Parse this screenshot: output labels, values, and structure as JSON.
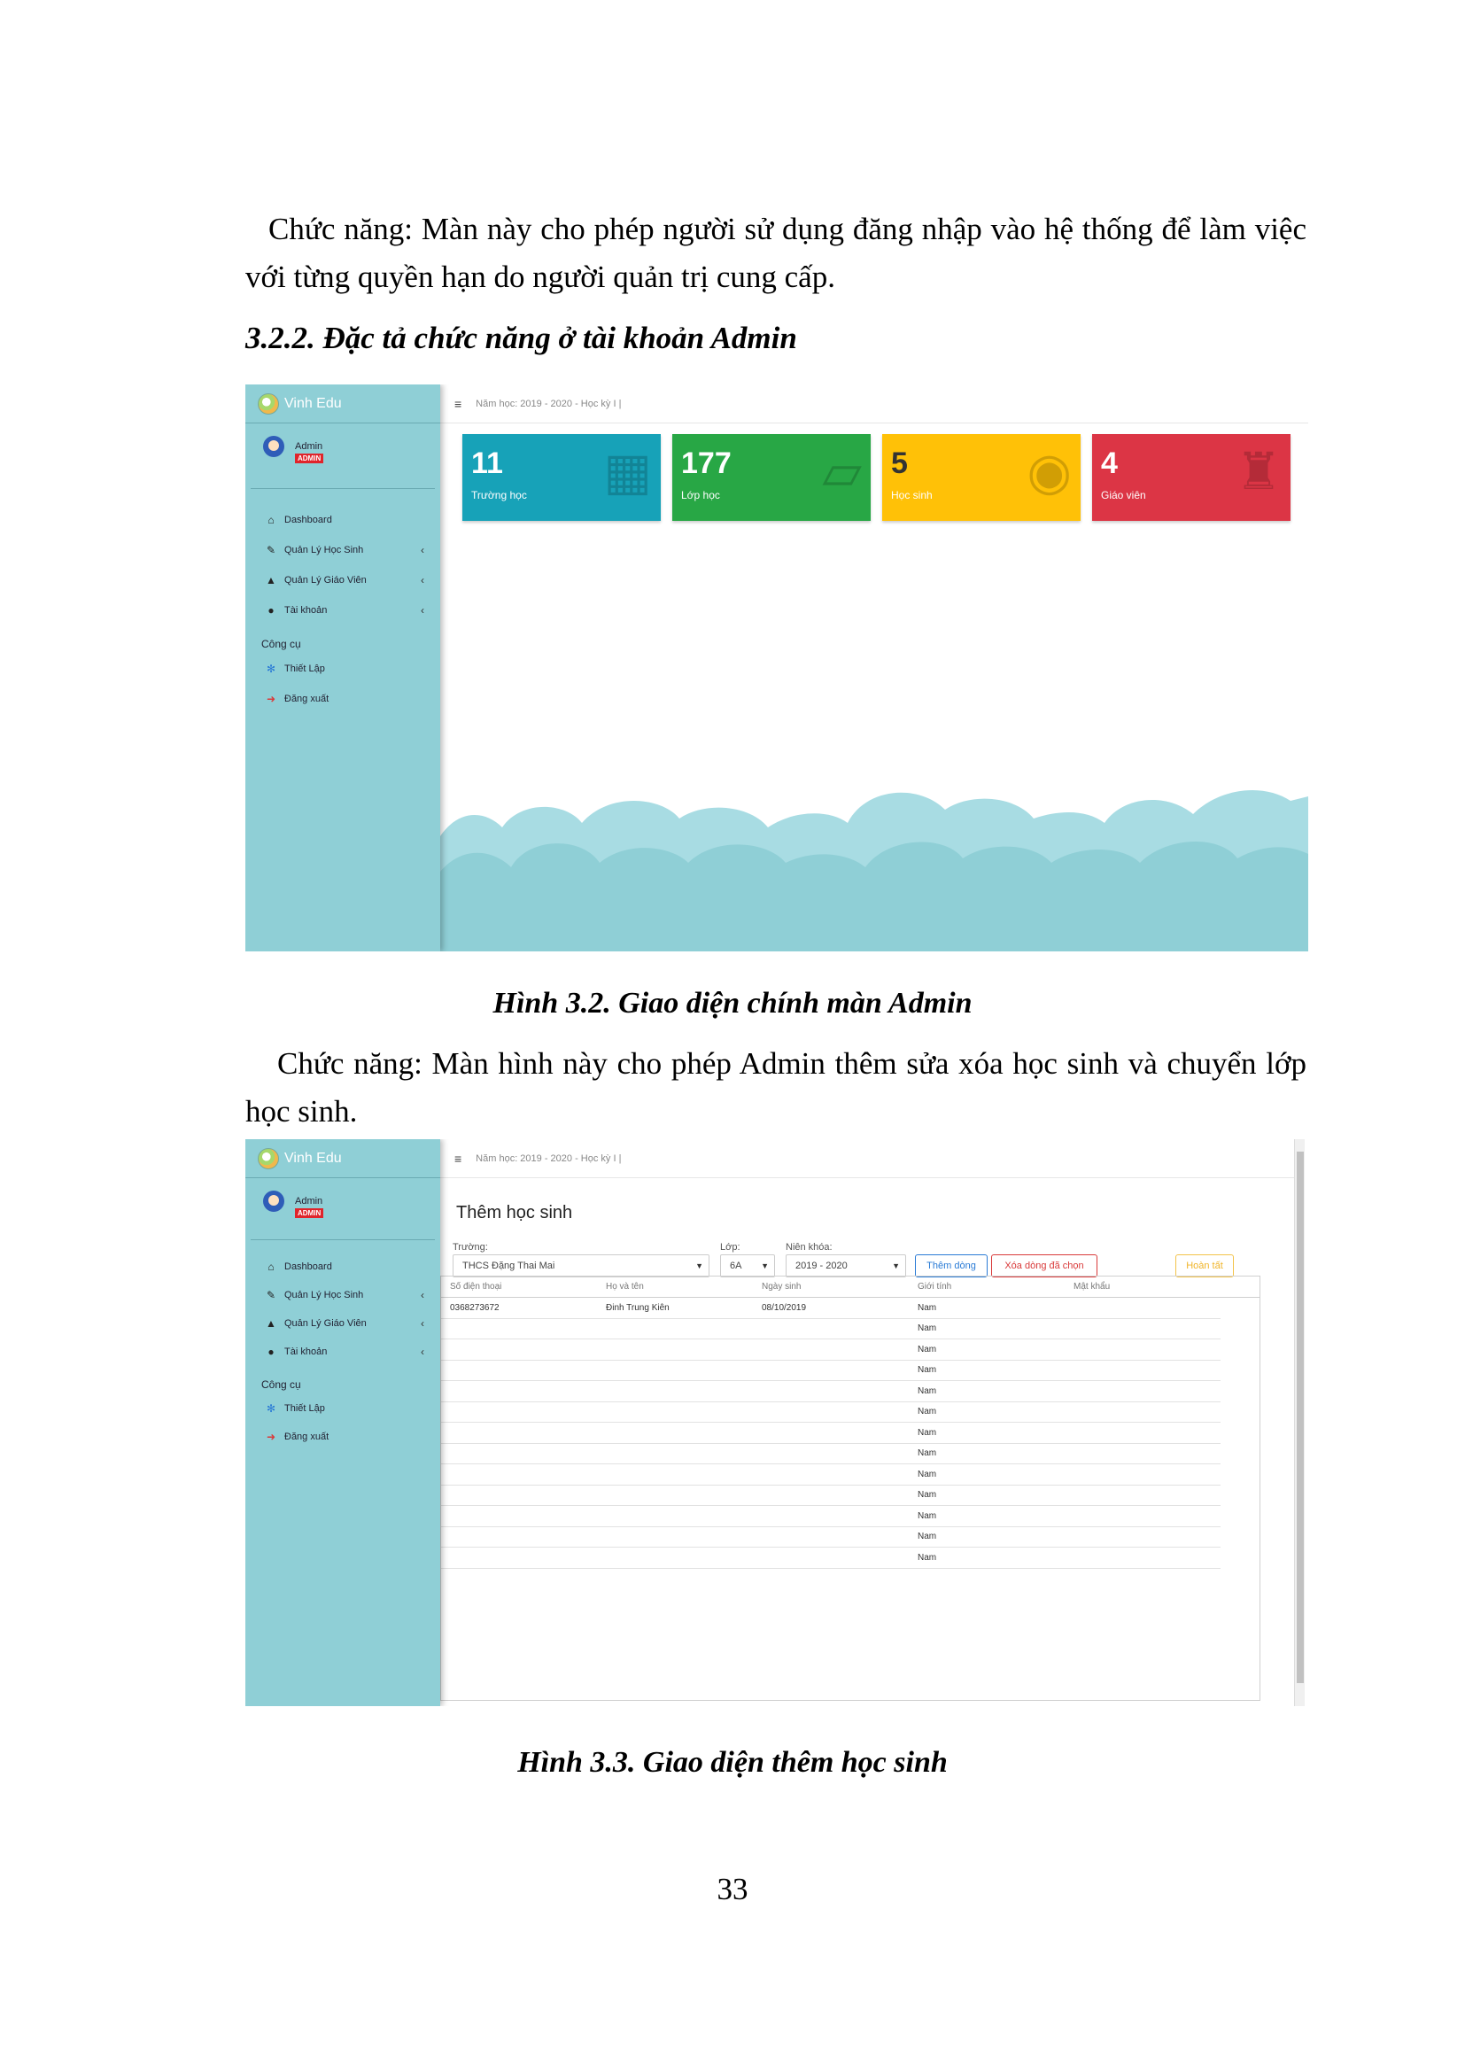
{
  "document": {
    "para1": "Chức năng: Màn này cho phép người sử dụng đăng nhập vào hệ thống để làm việc với từng quyền hạn do người quản trị cung cấp.",
    "heading": "3.2.2. Đặc tả chức năng ở tài khoản Admin",
    "caption1": "Hình 3.2. Giao diện chính màn Admin",
    "para2": "Chức năng: Màn hình này cho phép Admin thêm sửa xóa học sinh và chuyển lớp học sinh.",
    "caption2": "Hình 3.3. Giao diện thêm học sinh",
    "page_number": "33"
  },
  "app": {
    "brand": "Vinh Edu",
    "user_name": "Admin",
    "user_badge": "ADMIN",
    "topbar_text": "Năm học: 2019 - 2020 - Học kỳ I |",
    "menu": [
      {
        "label": "Dashboard",
        "icon": "home-icon"
      },
      {
        "label": "Quản Lý Học Sinh",
        "icon": "edit-icon",
        "chevron": "‹"
      },
      {
        "label": "Quản Lý Giáo Viên",
        "icon": "graduation-cap-icon",
        "chevron": "‹"
      },
      {
        "label": "Tài khoản",
        "icon": "user-circle-icon",
        "chevron": "‹"
      }
    ],
    "tools_section": "Công cụ",
    "tools": [
      {
        "label": "Thiết Lập",
        "icon": "cogs-icon"
      },
      {
        "label": "Đăng xuất",
        "icon": "sign-out-icon"
      }
    ]
  },
  "dashboard": {
    "cards": [
      {
        "value": "11",
        "label": "Trường học",
        "color": "#17a2b8",
        "icon": "building-icon"
      },
      {
        "value": "177",
        "label": "Lớp học",
        "color": "#28a745",
        "icon": "folder-open-icon"
      },
      {
        "value": "5",
        "label": "Học sinh",
        "color": "#ffc107",
        "icon": "user-circle-icon"
      },
      {
        "value": "4",
        "label": "Giáo viên",
        "color": "#dc3545",
        "icon": "user-secret-icon"
      }
    ]
  },
  "add_student": {
    "title": "Thêm học sinh",
    "school_label": "Trường:",
    "school_value": "THCS Đặng Thai Mai",
    "class_label": "Lớp:",
    "class_value": "6A",
    "year_label": "Niên khóa:",
    "year_value": "2019 - 2020",
    "btn_add_row": "Thêm dòng",
    "btn_delete_rows": "Xóa dòng đã chọn",
    "btn_done": "Hoàn tất",
    "columns": [
      "Số điện thoại",
      "Họ và tên",
      "Ngày sinh",
      "Giới tính",
      "Mật khẩu"
    ],
    "rows": [
      [
        "0368273672",
        "Đinh Trung Kiên",
        "08/10/2019",
        "Nam",
        ""
      ],
      [
        "",
        "",
        "",
        "Nam",
        ""
      ],
      [
        "",
        "",
        "",
        "Nam",
        ""
      ],
      [
        "",
        "",
        "",
        "Nam",
        ""
      ],
      [
        "",
        "",
        "",
        "Nam",
        ""
      ],
      [
        "",
        "",
        "",
        "Nam",
        ""
      ],
      [
        "",
        "",
        "",
        "Nam",
        ""
      ],
      [
        "",
        "",
        "",
        "Nam",
        ""
      ],
      [
        "",
        "",
        "",
        "Nam",
        ""
      ],
      [
        "",
        "",
        "",
        "Nam",
        ""
      ],
      [
        "",
        "",
        "",
        "Nam",
        ""
      ],
      [
        "",
        "",
        "",
        "Nam",
        ""
      ],
      [
        "",
        "",
        "",
        "Nam",
        ""
      ]
    ]
  }
}
